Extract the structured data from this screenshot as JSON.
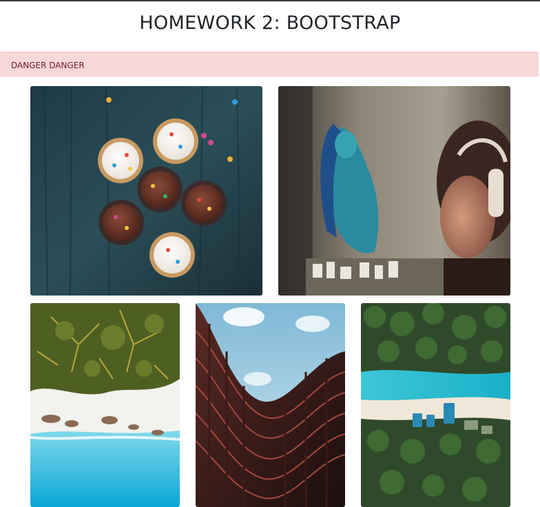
{
  "page": {
    "title": "HOMEWORK 2: BOOTSTRAP"
  },
  "alert": {
    "text": "DANGER DANGER",
    "background_color": "#f8d7da",
    "text_color": "#721c24"
  },
  "gallery": {
    "images": [
      {
        "name": "cupcakes-image"
      },
      {
        "name": "graffiti-headphones-image"
      },
      {
        "name": "aerial-beach-palms-image"
      },
      {
        "name": "curved-building-image"
      },
      {
        "name": "aerial-tropical-island-image"
      }
    ]
  }
}
